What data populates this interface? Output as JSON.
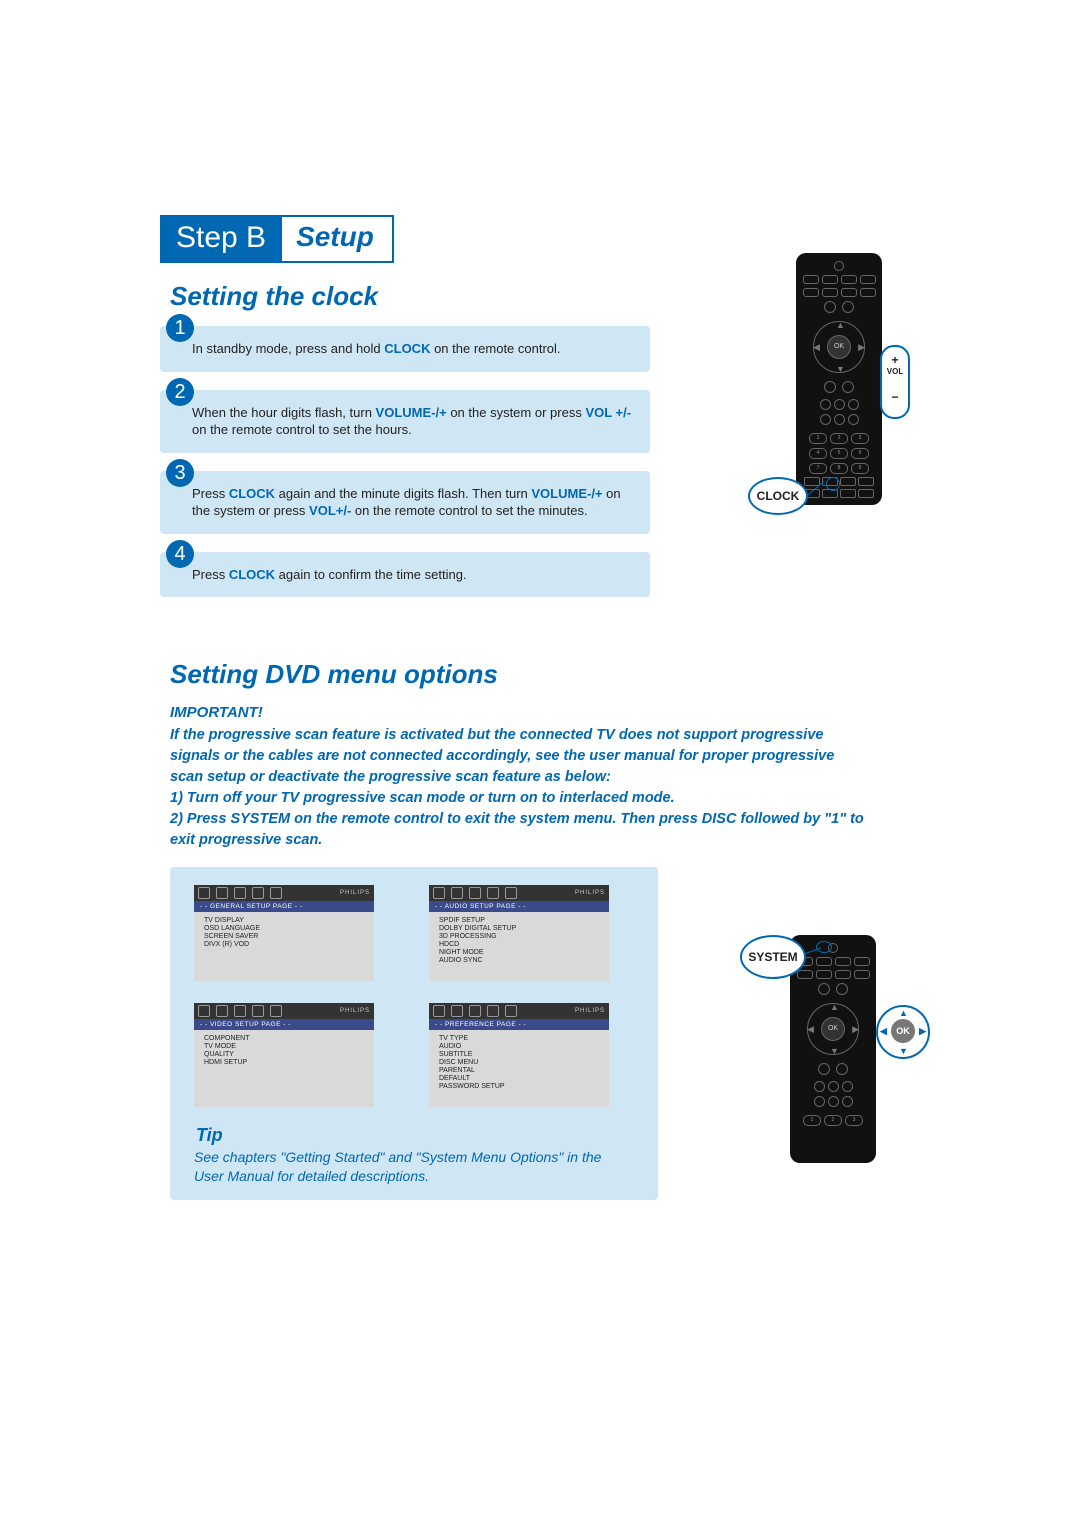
{
  "header": {
    "step": "Step B",
    "setup": "Setup"
  },
  "section1": {
    "title": "Setting the clock",
    "steps": [
      {
        "num": "1",
        "pre": "In standby mode, press and hold ",
        "bold1": "CLOCK",
        "post": " on the remote control."
      },
      {
        "num": "2",
        "pre": "When the hour digits flash, turn ",
        "bold1": "VOLUME-/+",
        "mid": " on the system or press ",
        "bold2": "VOL +/-",
        "post": " on the remote control to set the hours."
      },
      {
        "num": "3",
        "pre": "Press ",
        "bold1": "CLOCK",
        "mid": " again and the minute digits flash. Then turn ",
        "bold2": "VOLUME-/+",
        "mid2": " on the system or press ",
        "bold3": "VOL+/-",
        "post": " on the remote control to set the minutes."
      },
      {
        "num": "4",
        "pre": "Press ",
        "bold1": "CLOCK",
        "post": " again to confirm the time setting."
      }
    ]
  },
  "callouts": {
    "clock": "CLOCK",
    "system": "SYSTEM",
    "ok": "OK",
    "vol_plus": "+",
    "vol_label": "VOL",
    "vol_minus": "−"
  },
  "section2": {
    "title": "Setting DVD menu options",
    "important_label": "IMPORTANT!",
    "important_body": "If the progressive scan feature is activated but the connected TV does not support progressive signals or the cables are not connected accordingly, see the user manual for proper progressive scan setup or deactivate the progressive scan feature as below:\n1) Turn off your TV progressive scan mode or turn on to interlaced mode.\n2) Press SYSTEM on the remote control to exit the system menu. Then press DISC followed by \"1\" to exit progressive scan."
  },
  "menus": {
    "brand": "PHILIPS",
    "general": {
      "title": "- - GENERAL SETUP PAGE - -",
      "items": [
        "TV DISPLAY",
        "OSD LANGUAGE",
        "SCREEN SAVER",
        "DIVX (R) VOD"
      ]
    },
    "audio": {
      "title": "- - AUDIO SETUP PAGE - -",
      "items": [
        "SPDIF SETUP",
        "DOLBY DIGITAL SETUP",
        "3D PROCESSING",
        "HDCD",
        "NIGHT MODE",
        "AUDIO SYNC"
      ]
    },
    "video": {
      "title": "- - VIDEO SETUP PAGE - -",
      "items": [
        "COMPONENT",
        "TV MODE",
        "QUALITY",
        "HDMI SETUP"
      ]
    },
    "pref": {
      "title": "- - PREFERENCE PAGE - -",
      "items": [
        "TV TYPE",
        "AUDIO",
        "SUBTITLE",
        "DISC MENU",
        "PARENTAL",
        "DEFAULT",
        "PASSWORD SETUP"
      ]
    }
  },
  "tip": {
    "title": "Tip",
    "body": "See chapters \"Getting Started\" and \"System Menu Options\" in the User Manual for detailed descriptions."
  },
  "remote_numbers": [
    "1",
    "2",
    "3",
    "4",
    "5",
    "6",
    "7",
    "8",
    "9"
  ]
}
